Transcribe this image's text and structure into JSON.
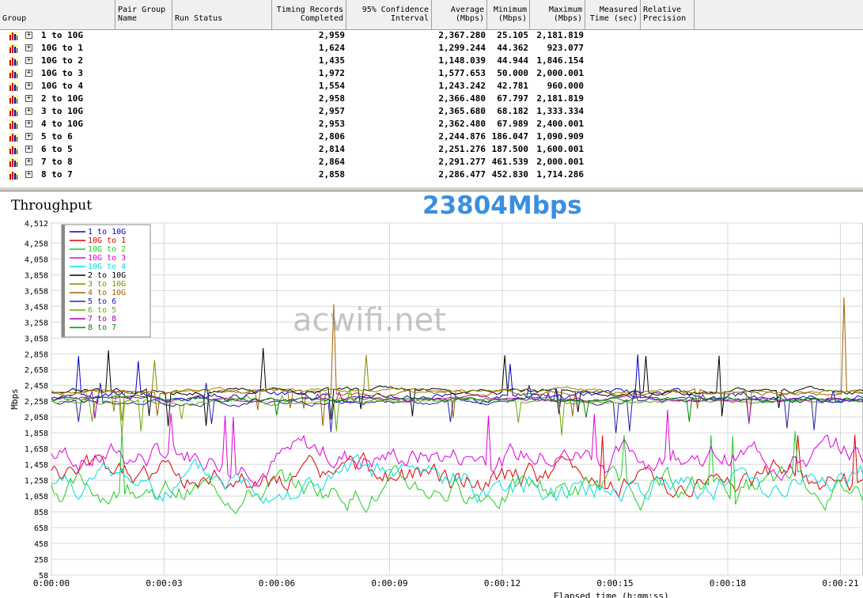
{
  "table": {
    "headers": {
      "group": "Group",
      "pair_group": "Pair Group\nName",
      "run_status": "Run Status",
      "timing": "Timing Records\nCompleted",
      "confidence": "95% Confidence\nInterval",
      "average": "Average\n(Mbps)",
      "minimum": "Minimum\n(Mbps)",
      "maximum": "Maximum\n(Mbps)",
      "measured": "Measured\nTime (sec)",
      "precision": "Relative\nPrecision"
    },
    "rows": [
      {
        "group": "1 to 10G",
        "records": "2,959",
        "average": "2,367.280",
        "minimum": "25.105",
        "maximum": "2,181.819"
      },
      {
        "group": "10G to 1",
        "records": "1,624",
        "average": "1,299.244",
        "minimum": "44.362",
        "maximum": "923.077"
      },
      {
        "group": "10G to 2",
        "records": "1,435",
        "average": "1,148.039",
        "minimum": "44.944",
        "maximum": "1,846.154"
      },
      {
        "group": "10G to 3",
        "records": "1,972",
        "average": "1,577.653",
        "minimum": "50.000",
        "maximum": "2,000.001"
      },
      {
        "group": "10G to 4",
        "records": "1,554",
        "average": "1,243.242",
        "minimum": "42.781",
        "maximum": "960.000"
      },
      {
        "group": "2 to 10G",
        "records": "2,958",
        "average": "2,366.480",
        "minimum": "67.797",
        "maximum": "2,181.819"
      },
      {
        "group": "3 to 10G",
        "records": "2,957",
        "average": "2,365.680",
        "minimum": "68.182",
        "maximum": "1,333.334"
      },
      {
        "group": "4 to 10G",
        "records": "2,953",
        "average": "2,362.480",
        "minimum": "67.989",
        "maximum": "2,400.001"
      },
      {
        "group": "5 to 6",
        "records": "2,806",
        "average": "2,244.876",
        "minimum": "186.047",
        "maximum": "1,090.909"
      },
      {
        "group": "6 to 5",
        "records": "2,814",
        "average": "2,251.276",
        "minimum": "187.500",
        "maximum": "1,600.001"
      },
      {
        "group": "7 to 8",
        "records": "2,864",
        "average": "2,291.277",
        "minimum": "461.539",
        "maximum": "2,000.001"
      },
      {
        "group": "8 to 7",
        "records": "2,858",
        "average": "2,286.477",
        "minimum": "452.830",
        "maximum": "1,714.286"
      }
    ]
  },
  "chart_title": "Throughput",
  "big_label": "23804Mbps",
  "watermark": "acwifi.net",
  "chart_data": {
    "type": "line",
    "title": "Throughput",
    "ylabel": "Mbps",
    "xlabel": "Elapsed time (h:mm:ss)",
    "ylim": [
      58,
      4512
    ],
    "xlim": [
      0,
      21.6
    ],
    "y_ticks": [
      "58",
      "258",
      "458",
      "658",
      "858",
      "1,058",
      "1,258",
      "1,458",
      "1,658",
      "1,858",
      "2,058",
      "2,258",
      "2,458",
      "2,658",
      "2,858",
      "3,058",
      "3,258",
      "3,458",
      "3,658",
      "3,858",
      "4,058",
      "4,258",
      "4,512"
    ],
    "y_tick_values": [
      58,
      258,
      458,
      658,
      858,
      1058,
      1258,
      1458,
      1658,
      1858,
      2058,
      2258,
      2458,
      2658,
      2858,
      3058,
      3258,
      3458,
      3658,
      3858,
      4058,
      4258,
      4512
    ],
    "x_ticks": [
      "0:00:00",
      "0:00:03",
      "0:00:06",
      "0:00:09",
      "0:00:12",
      "0:00:15",
      "0:00:18",
      "0:00:21"
    ],
    "x_tick_values": [
      0,
      3,
      6,
      9,
      12,
      15,
      18,
      21
    ],
    "grid": true,
    "legend_position": "top-left",
    "series": [
      {
        "name": "1 to 10G",
        "color": "#0000cc",
        "mean": 2330,
        "amp": 110,
        "spike": 2850,
        "seed": 1
      },
      {
        "name": "10G to 1",
        "color": "#dd0000",
        "mean": 1290,
        "amp": 330,
        "spike": 1900,
        "seed": 2
      },
      {
        "name": "10G to 2",
        "color": "#22cc22",
        "mean": 1150,
        "amp": 320,
        "spike": 1900,
        "seed": 3
      },
      {
        "name": "10G to 3",
        "color": "#dd00dd",
        "mean": 1580,
        "amp": 330,
        "spike": 2150,
        "seed": 4
      },
      {
        "name": "10G to 4",
        "color": "#00dddd",
        "mean": 1240,
        "amp": 330,
        "spike": 1850,
        "seed": 5
      },
      {
        "name": "2 to 10G",
        "color": "#000000",
        "mean": 2380,
        "amp": 70,
        "spike": 2950,
        "seed": 6
      },
      {
        "name": "3 to 10G",
        "color": "#888800",
        "mean": 2380,
        "amp": 55,
        "spike": 2850,
        "seed": 7
      },
      {
        "name": "4 to 10G",
        "color": "#a06000",
        "mean": 2370,
        "amp": 60,
        "spike": 3600,
        "seed": 8
      },
      {
        "name": "5 to 6",
        "color": "#2020aa",
        "mean": 2250,
        "amp": 70,
        "spike": 2500,
        "seed": 9
      },
      {
        "name": "6 to 5",
        "color": "#66aa00",
        "mean": 2260,
        "amp": 60,
        "spike": 2450,
        "seed": 10
      },
      {
        "name": "7 to 8",
        "color": "#aa00aa",
        "mean": 2290,
        "amp": 50,
        "spike": 2400,
        "seed": 11
      },
      {
        "name": "8 to 7",
        "color": "#008800",
        "mean": 2290,
        "amp": 50,
        "spike": 2400,
        "seed": 12
      }
    ]
  }
}
